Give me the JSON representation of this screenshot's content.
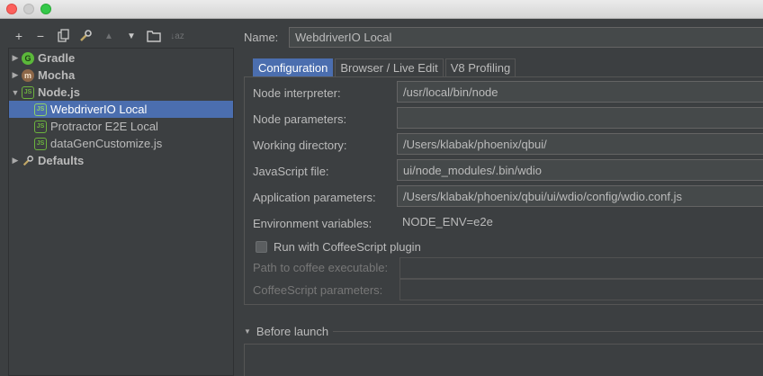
{
  "window": {
    "traffic_lights": [
      "close",
      "minimize",
      "zoom"
    ]
  },
  "toolbar": {
    "icons": [
      "add-icon",
      "remove-icon",
      "copy-icon",
      "wrench-icon",
      "move-up-icon",
      "move-down-icon",
      "folder-icon",
      "sort-icon"
    ],
    "add_glyph": "+",
    "remove_glyph": "−",
    "sort_glyph": "↓az"
  },
  "tree": {
    "items": [
      {
        "label": "Gradle",
        "icon": "gradle-icon",
        "expanded": false,
        "bold": true,
        "glyph": "G"
      },
      {
        "label": "Mocha",
        "icon": "mocha-icon",
        "expanded": false,
        "bold": true,
        "glyph": "m"
      },
      {
        "label": "Node.js",
        "icon": "nodejs-icon",
        "expanded": true,
        "bold": true,
        "glyph": "JS"
      },
      {
        "label": "WebdriverIO Local",
        "icon": "nodejs-icon",
        "selected": true,
        "glyph": "JS"
      },
      {
        "label": "Protractor E2E Local",
        "icon": "nodejs-icon",
        "glyph": "JS"
      },
      {
        "label": "dataGenCustomize.js",
        "icon": "nodejs-icon",
        "glyph": "JS"
      },
      {
        "label": "Defaults",
        "icon": "wrench-icon",
        "expanded": false,
        "bold": true,
        "glyph": "🔧"
      }
    ]
  },
  "name": {
    "label": "Name:",
    "value": "WebdriverIO Local"
  },
  "tabs": [
    {
      "label": "Configuration",
      "active": true
    },
    {
      "label": "Browser / Live Edit"
    },
    {
      "label": "V8 Profiling"
    }
  ],
  "config": {
    "node_interpreter": {
      "label": "Node interpreter:",
      "value": "/usr/local/bin/node"
    },
    "node_parameters": {
      "label": "Node parameters:",
      "value": ""
    },
    "working_directory": {
      "label": "Working directory:",
      "value": "/Users/klabak/phoenix/qbui/"
    },
    "javascript_file": {
      "label": "JavaScript file:",
      "value": "ui/node_modules/.bin/wdio"
    },
    "application_parameters": {
      "label": "Application parameters:",
      "value": "/Users/klabak/phoenix/qbui/ui/wdio/config/wdio.conf.js"
    },
    "environment_variables": {
      "label": "Environment variables:",
      "value": "NODE_ENV=e2e"
    },
    "coffeescript_checkbox": {
      "label": "Run with CoffeeScript plugin",
      "checked": false
    },
    "coffee_path": {
      "label": "Path to coffee executable:",
      "value": ""
    },
    "coffee_params": {
      "label": "CoffeeScript parameters:",
      "value": ""
    }
  },
  "before_launch": {
    "label": "Before launch"
  }
}
